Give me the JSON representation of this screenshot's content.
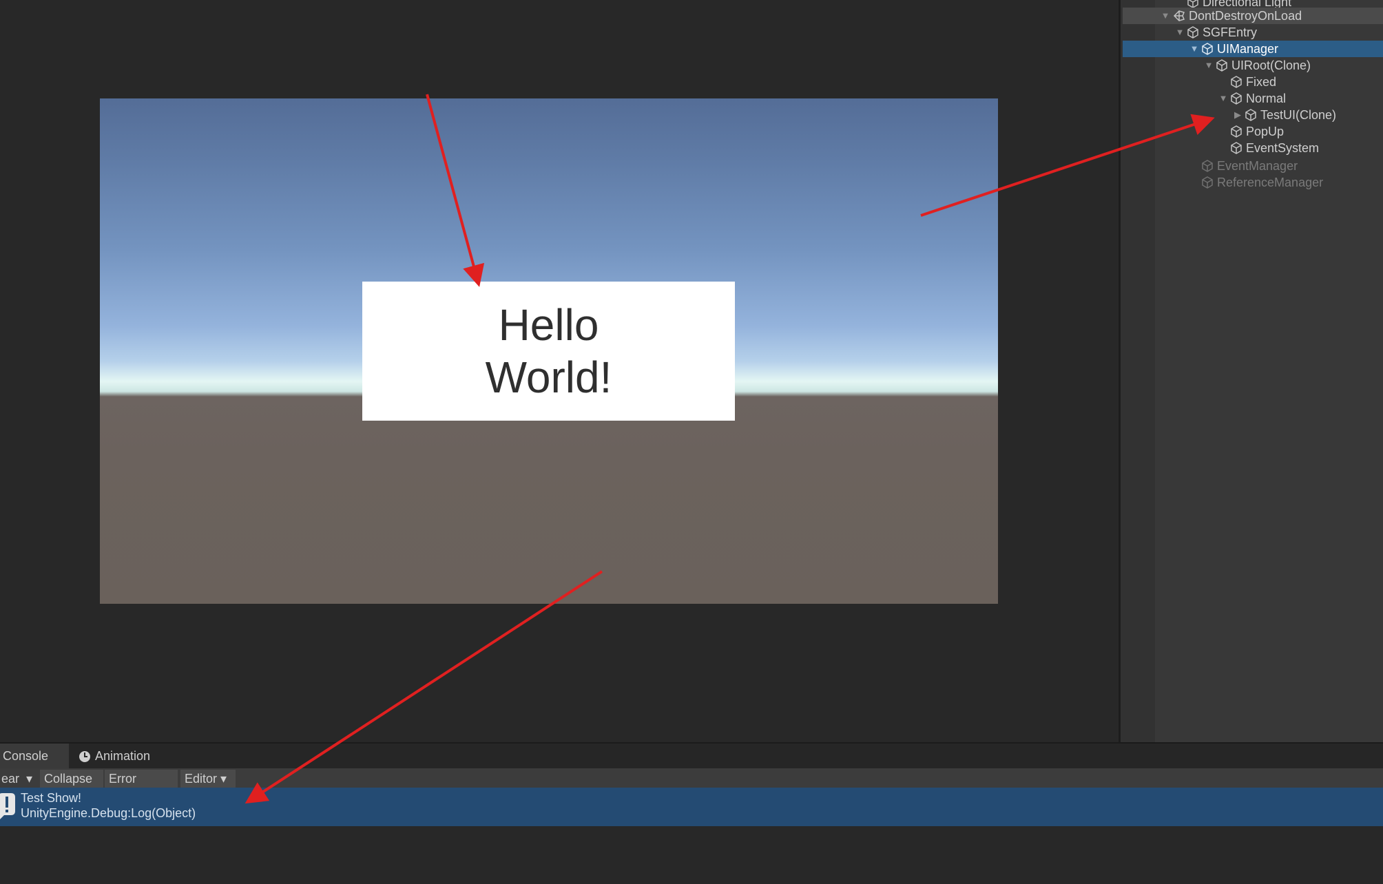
{
  "game": {
    "hello_text": "Hello\nWorld!"
  },
  "hierarchy": {
    "items": [
      {
        "label": "Directional Light",
        "arrow": "",
        "state": "normal"
      },
      {
        "label": "DontDestroyOnLoad",
        "arrow": "▼",
        "state": "highlight",
        "icon": "unity-scene-icon"
      },
      {
        "label": "SGFEntry",
        "arrow": "▼",
        "state": "normal"
      },
      {
        "label": "UIManager",
        "arrow": "▼",
        "state": "selected"
      },
      {
        "label": "UIRoot(Clone)",
        "arrow": "▼",
        "state": "normal"
      },
      {
        "label": "Fixed",
        "arrow": "",
        "state": "normal"
      },
      {
        "label": "Normal",
        "arrow": "▼",
        "state": "normal"
      },
      {
        "label": "TestUI(Clone)",
        "arrow": "▶",
        "state": "normal"
      },
      {
        "label": "PopUp",
        "arrow": "",
        "state": "normal"
      },
      {
        "label": "EventSystem",
        "arrow": "",
        "state": "normal"
      },
      {
        "label": "EventManager",
        "arrow": "",
        "state": "dim"
      },
      {
        "label": "ReferenceManager",
        "arrow": "",
        "state": "dim"
      }
    ]
  },
  "console": {
    "tabs": {
      "console": "Console",
      "animation": "Animation"
    },
    "toolbar": {
      "clear": "ear",
      "dropdown": "▾",
      "collapse": "Collapse",
      "error_pause": "Error Pause",
      "editor": "Editor ▾"
    },
    "log": {
      "line1": "Test Show!",
      "line2": "UnityEngine.Debug:Log(Object)"
    }
  },
  "colors": {
    "selection": "#2c5d87",
    "log_selected": "#244b73",
    "annotation_arrow": "#e02020"
  }
}
